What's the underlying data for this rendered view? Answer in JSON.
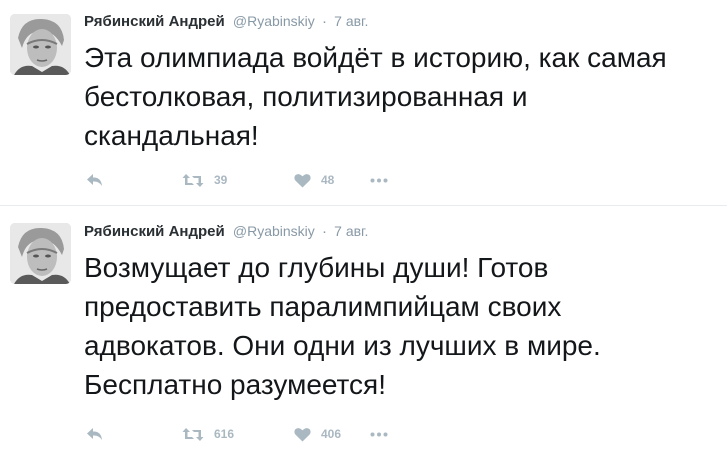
{
  "tweets": [
    {
      "author_name": "Рябинский Андрей",
      "handle": "@Ryabinskiy",
      "separator": "·",
      "time": "7 авг.",
      "text": "Эта олимпиада войдёт в историю, как самая бестолковая, политизированная и скандальная!",
      "retweets": "39",
      "likes": "48"
    },
    {
      "author_name": "Рябинский Андрей",
      "handle": "@Ryabinskiy",
      "separator": "·",
      "time": "7 авг.",
      "text": "Возмущает до глубины души! Готов предоставить паралимпийцам своих адвокатов. Они одни из лучших в мире. Бесплатно разумеется!",
      "retweets": "616",
      "likes": "406"
    }
  ],
  "icons": {
    "reply": "reply-icon",
    "retweet": "retweet-icon",
    "like": "heart-icon",
    "more": "more-icon"
  },
  "colors": {
    "action_icon": "#aab8c2",
    "handle": "#8899a6",
    "divider": "#e6ecf0"
  }
}
